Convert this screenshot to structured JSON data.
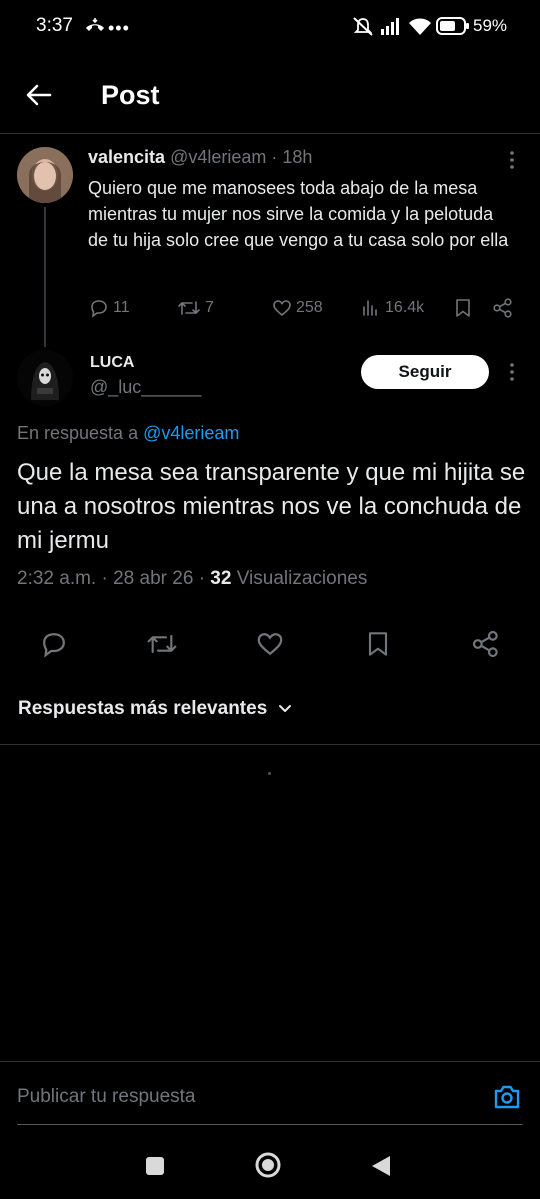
{
  "status_bar": {
    "time": "3:37",
    "battery": "59%"
  },
  "header": {
    "title": "Post"
  },
  "parent_post": {
    "display_name": "valencita",
    "handle": "@v4lerieam",
    "separator": "·",
    "age": "18h",
    "text": "Quiero que me manosees toda abajo de la mesa mientras tu mujer nos sirve la comida y la pelotuda de tu hija solo cree que vengo a tu casa solo por ella",
    "replies": "11",
    "reposts": "7",
    "likes": "258",
    "views": "16.4k"
  },
  "post": {
    "display_name": "LUCA",
    "handle": "@_luc______",
    "follow_label": "Seguir",
    "reply_prefix": "En respuesta a",
    "reply_mention": "@v4lerieam",
    "text": "Que la mesa sea transparente y que mi hijita se una a nosotros mientras nos ve la conchuda de mi jermu",
    "time": "2:32 a.m.",
    "date": "28 abr 26",
    "views_count": "32",
    "views_label": "Visualizaciones"
  },
  "replies_sort": {
    "label": "Respuestas más relevantes"
  },
  "composer": {
    "placeholder": "Publicar tu respuesta"
  },
  "colors": {
    "accent": "#1d9bf0",
    "background": "#000000",
    "secondary_text": "#71767b"
  }
}
